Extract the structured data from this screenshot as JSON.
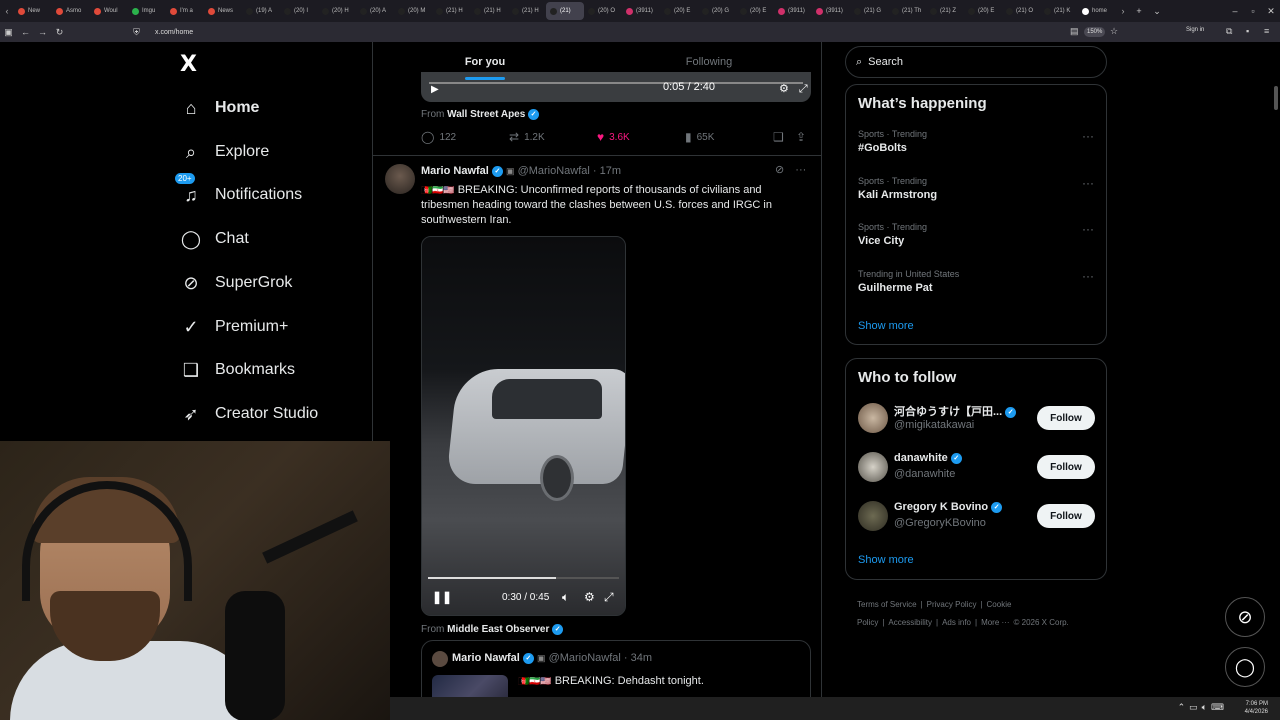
{
  "browser": {
    "tabs": [
      {
        "label": "New",
        "color": "#e04a3a"
      },
      {
        "label": "Asmo",
        "color": "#e04a3a"
      },
      {
        "label": "Woul",
        "color": "#e04a3a"
      },
      {
        "label": "Imgu",
        "color": "#2bb24c"
      },
      {
        "label": "I'm a",
        "color": "#e04a3a"
      },
      {
        "label": "News",
        "color": "#e04a3a"
      },
      {
        "label": "(19) A",
        "color": "#222"
      },
      {
        "label": "(20) I",
        "color": "#222"
      },
      {
        "label": "(20) H",
        "color": "#222"
      },
      {
        "label": "(20) A",
        "color": "#222"
      },
      {
        "label": "(20) M",
        "color": "#222"
      },
      {
        "label": "(21) H",
        "color": "#222"
      },
      {
        "label": "(21) H",
        "color": "#222"
      },
      {
        "label": "(21) H",
        "color": "#222"
      },
      {
        "label": "(21)",
        "color": "#222"
      },
      {
        "label": "(20) O",
        "color": "#222"
      },
      {
        "label": "(3911)",
        "color": "#d0306a"
      },
      {
        "label": "(20) E",
        "color": "#222"
      },
      {
        "label": "(20) G",
        "color": "#222"
      },
      {
        "label": "(20) E",
        "color": "#222"
      },
      {
        "label": "(3911)",
        "color": "#d0306a"
      },
      {
        "label": "(3911)",
        "color": "#d0306a"
      },
      {
        "label": "(21) G",
        "color": "#222"
      },
      {
        "label": "(21) Th",
        "color": "#222"
      },
      {
        "label": "(21) Z",
        "color": "#222"
      },
      {
        "label": "(20) E",
        "color": "#222"
      },
      {
        "label": "(21) O",
        "color": "#222"
      },
      {
        "label": "(21) K",
        "color": "#222"
      },
      {
        "label": "home",
        "color": "#fff"
      }
    ],
    "active_tab_index": 14,
    "url": "x.com/home",
    "zoom": "150%",
    "signin_label": "Sign in"
  },
  "nav": {
    "logo": "X",
    "items": [
      {
        "label": "Home",
        "icon": "home-icon",
        "glyph": "⌂"
      },
      {
        "label": "Explore",
        "icon": "search-icon",
        "glyph": "⌕"
      },
      {
        "label": "Notifications",
        "icon": "bell-icon",
        "glyph": "♫",
        "badge": "20+"
      },
      {
        "label": "Chat",
        "icon": "chat-icon",
        "glyph": "◯"
      },
      {
        "label": "SuperGrok",
        "icon": "grok-icon",
        "glyph": "⊘"
      },
      {
        "label": "Premium+",
        "icon": "premium-icon",
        "glyph": "✓"
      },
      {
        "label": "Bookmarks",
        "icon": "bookmark-icon",
        "glyph": "❑"
      },
      {
        "label": "Creator Studio",
        "icon": "rocket-icon",
        "glyph": "➶"
      }
    ]
  },
  "feed": {
    "tabs": [
      "For you",
      "Following"
    ],
    "prev_post": {
      "video_time": "0:05 / 2:40",
      "from_label": "From",
      "from_name": "Wall Street Apes",
      "replies": "122",
      "reposts": "1.2K",
      "likes": "3.6K",
      "views": "65K"
    },
    "post": {
      "name": "Mario Nawfal",
      "handle": "@MarioNawfal",
      "time": "· 17m",
      "flags": "🇦🇫🇮🇷🇺🇸",
      "text": "BREAKING: Unconfirmed reports of thousands of civilians and tribesmen heading toward the clashes between U.S. forces and IRGC in southwestern Iran.",
      "video_time": "0:30 / 0:45",
      "video_progress": 0.67,
      "from_label": "From",
      "from_name": "Middle East Observer"
    },
    "quote": {
      "name": "Mario Nawfal",
      "handle": "@MarioNawfal",
      "time": "· 34m",
      "text": "BREAKING: Dehdasht tonight."
    }
  },
  "sidebar": {
    "search_placeholder": "Search",
    "happening_title": "What’s happening",
    "trends": [
      {
        "category": "Sports · Trending",
        "name": "#GoBolts"
      },
      {
        "category": "Sports · Trending",
        "name": "Kali Armstrong"
      },
      {
        "category": "Sports · Trending",
        "name": "Vice City"
      },
      {
        "category": "Trending in United States",
        "name": "Guilherme Pat"
      }
    ],
    "show_more": "Show more",
    "wtf_title": "Who to follow",
    "wtf": [
      {
        "name": "河合ゆうすけ【戸田...",
        "handle": "@migikatakawai",
        "button": "Follow"
      },
      {
        "name": "danawhite",
        "handle": "@danawhite",
        "button": "Follow"
      },
      {
        "name": "Gregory K Bovino",
        "handle": "@GregoryKBovino",
        "button": "Follow"
      }
    ],
    "footer": [
      "Terms of Service",
      "|",
      "Privacy Policy",
      "|",
      "Cookie Policy",
      "|",
      "Accessibility",
      "|",
      "Ads info",
      "|",
      "More ···",
      "© 2026 X Corp."
    ]
  },
  "taskbar": {
    "time": "7:06 PM",
    "date": "4/4/2026"
  },
  "colors": {
    "accent": "#1d9bf0",
    "like": "#f91880",
    "background": "#000000",
    "border": "#2f3336"
  }
}
